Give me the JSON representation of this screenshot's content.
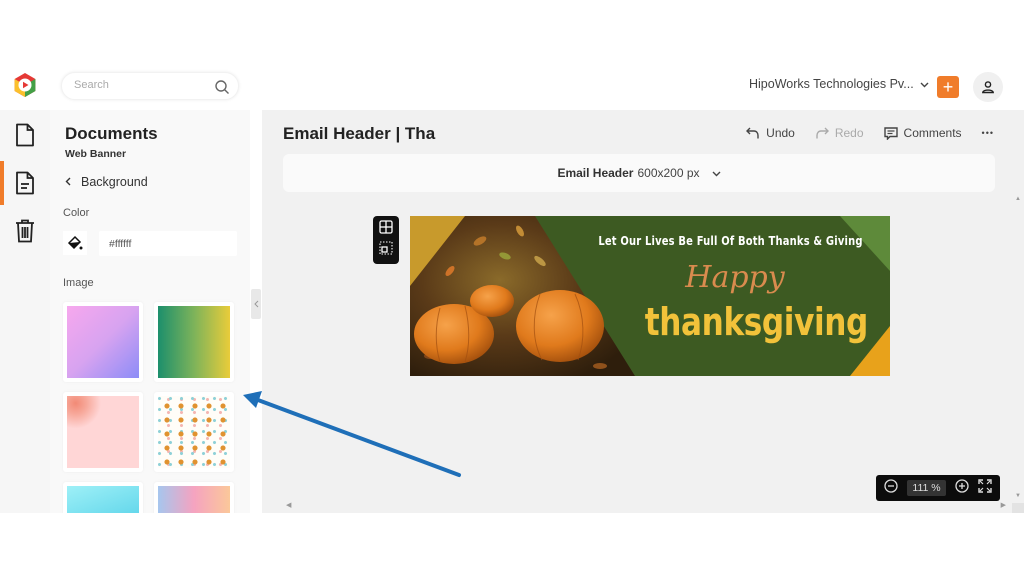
{
  "topbar": {
    "search_placeholder": "Search",
    "org_name": "HipoWorks Technologies Pv...",
    "add_label": "+",
    "brand_color": "#f07c2a"
  },
  "rail": {
    "items": [
      {
        "name": "documents",
        "icon": "document-icon",
        "active": false
      },
      {
        "name": "text-document",
        "icon": "text-document-icon",
        "active": true
      },
      {
        "name": "trash",
        "icon": "trash-icon",
        "active": false
      }
    ]
  },
  "panel": {
    "title": "Documents",
    "subtitle": "Web Banner",
    "back_label": "Background",
    "color_label": "Color",
    "color_value": "#ffffff",
    "image_label": "Image",
    "thumbnails": [
      {
        "name": "pink-purple-gradient"
      },
      {
        "name": "green-yellow-gradient"
      },
      {
        "name": "pink-floral"
      },
      {
        "name": "coffee-pattern"
      },
      {
        "name": "cyan-gradient"
      },
      {
        "name": "blue-pink-peach-gradient"
      }
    ]
  },
  "main": {
    "doc_title": "Email Header | Tha",
    "toolbar": {
      "undo": "Undo",
      "redo": "Redo",
      "comments": "Comments",
      "more": "•••"
    },
    "size_bar": {
      "name": "Email Header",
      "dims": "600x200 px"
    },
    "banner": {
      "tagline": "Let Our Lives Be Full Of Both Thanks & Giving",
      "happy": "Happy",
      "headline": "thanksgiving",
      "colors": {
        "green": "#3d5a22",
        "gold": "#e8a21b",
        "headline": "#f2c23a",
        "happy": "#d98b4e"
      }
    },
    "zoom": {
      "value": "111 %"
    }
  }
}
